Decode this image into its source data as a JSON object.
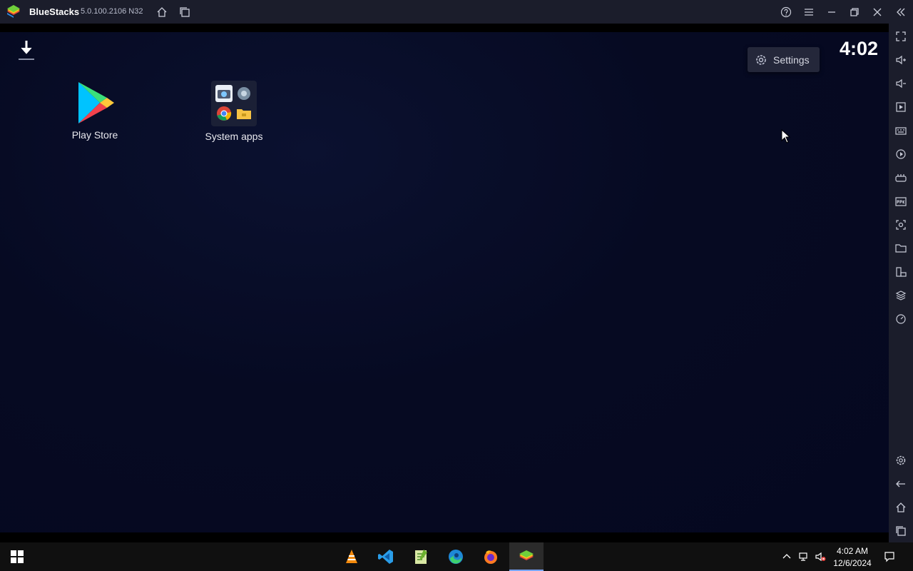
{
  "window": {
    "title": "BlueStacks",
    "version": "5.0.100.2106 N32"
  },
  "screen": {
    "clock": "4:02",
    "settings_tooltip": "Settings",
    "apps": [
      {
        "label": "Play Store"
      },
      {
        "label": "System apps"
      }
    ]
  },
  "taskbar": {
    "time": "4:02 AM",
    "date": "12/6/2024",
    "pinned": [
      "vlc-icon",
      "vscode-icon",
      "notepad-plus-plus-icon",
      "edge-icon",
      "firefox-icon",
      "bluestacks-icon"
    ]
  },
  "colors": {
    "titlebar": "#1b1d2b",
    "screen": "#060a22",
    "taskbar": "#101010",
    "active_underline": "#77a5ff"
  }
}
